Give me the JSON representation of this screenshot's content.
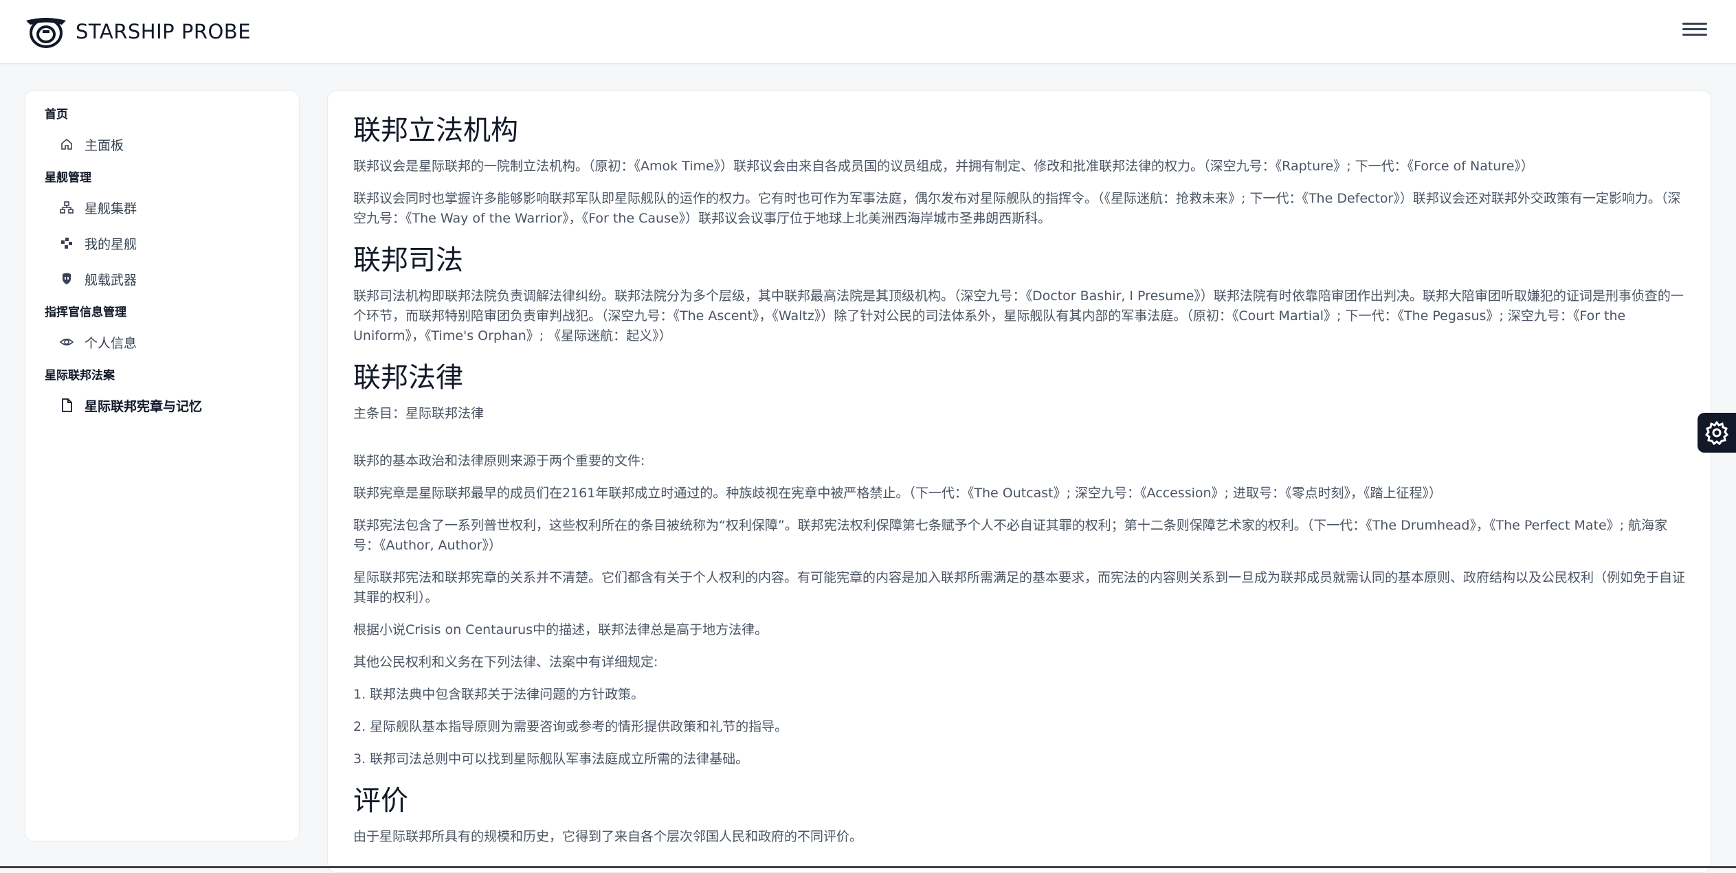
{
  "app": {
    "title": "STARSHIP PROBE"
  },
  "sidebar": {
    "groups": [
      {
        "title": "首页",
        "items": [
          {
            "label": "主面板",
            "icon": "home-icon"
          }
        ]
      },
      {
        "title": "星舰管理",
        "items": [
          {
            "label": "星舰集群",
            "icon": "cluster-icon"
          },
          {
            "label": "我的星舰",
            "icon": "grid-icon"
          },
          {
            "label": "舰载武器",
            "icon": "shield-icon"
          }
        ]
      },
      {
        "title": "指挥官信息管理",
        "items": [
          {
            "label": "个人信息",
            "icon": "eye-icon"
          }
        ]
      },
      {
        "title": "星际联邦法案",
        "items": [
          {
            "label": "星际联邦宪章与记忆",
            "icon": "file-icon",
            "active": true
          }
        ]
      }
    ]
  },
  "content": {
    "sections": [
      {
        "heading": "联邦立法机构",
        "paragraphs": [
          "联邦议会是星际联邦的一院制立法机构。（原初：《Amok Time》）联邦议会由来自各成员国的议员组成，并拥有制定、修改和批准联邦法律的权力。（深空九号：《Rapture》; 下一代：《Force of Nature》）",
          "联邦议会同时也掌握许多能够影响联邦军队即星际舰队的运作的权力。它有时也可作为军事法庭，偶尔发布对星际舰队的指挥令。（《星际迷航：抢救未来》; 下一代：《The Defector》）联邦议会还对联邦外交政策有一定影响力。（深空九号：《The Way of the Warrior》，《For the Cause》）联邦议会议事厅位于地球上北美洲西海岸城市圣弗朗西斯科。"
        ]
      },
      {
        "heading": "联邦司法",
        "paragraphs": [
          "联邦司法机构即联邦法院负责调解法律纠纷。联邦法院分为多个层级，其中联邦最高法院是其顶级机构。（深空九号：《Doctor Bashir, I Presume》）联邦法院有时依靠陪审团作出判决。联邦大陪审团听取嫌犯的证词是刑事侦查的一个环节，而联邦特别陪审团负责审判战犯。（深空九号：《The Ascent》，《Waltz》）除了针对公民的司法体系外，星际舰队有其内部的军事法庭。（原初：《Court Martial》; 下一代：《The Pegasus》; 深空九号：《For the Uniform》，《Time's Orphan》; 《星际迷航：起义》）"
        ]
      },
      {
        "heading": "联邦法律",
        "paragraphs": [
          "主条目：星际联邦法律"
        ],
        "paragraphs_after_gap": [
          "联邦的基本政治和法律原则来源于两个重要的文件:",
          "联邦宪章是星际联邦最早的成员们在2161年联邦成立时通过的。种族歧视在宪章中被严格禁止。（下一代：《The Outcast》; 深空九号：《Accession》; 进取号：《零点时刻》，《踏上征程》）",
          "联邦宪法包含了一系列普世权利，这些权利所在的条目被统称为“权利保障”。联邦宪法权利保障第七条赋予个人不必自证其罪的权利；第十二条则保障艺术家的权利。（下一代：《The Drumhead》，《The Perfect Mate》; 航海家号：《Author, Author》）",
          "星际联邦宪法和联邦宪章的关系并不清楚。它们都含有关于个人权利的内容。有可能宪章的内容是加入联邦所需满足的基本要求，而宪法的内容则关系到一旦成为联邦成员就需认同的基本原则、政府结构以及公民权利（例如免于自证其罪的权利）。",
          "根据小说Crisis on Centaurus中的描述，联邦法律总是高于地方法律。",
          "其他公民权利和义务在下列法律、法案中有详细规定:",
          "1. 联邦法典中包含联邦关于法律问题的方针政策。",
          "2. 星际舰队基本指导原则为需要咨询或参考的情形提供政策和礼节的指导。",
          "3. 联邦司法总则中可以找到星际舰队军事法庭成立所需的法律基础。"
        ]
      },
      {
        "heading": "评价",
        "paragraphs": [
          "由于星际联邦所具有的规模和历史，它得到了来自各个层次邻国人民和政府的不同评价。"
        ]
      }
    ]
  }
}
